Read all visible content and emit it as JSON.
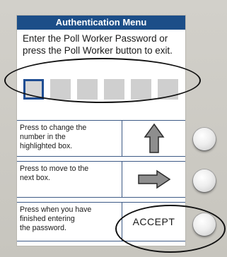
{
  "screen": {
    "title": "Authentication Menu",
    "prompt_line1": "Enter the Poll Worker Password or",
    "prompt_line2": "press the Poll Worker button to exit.",
    "password_box_count": 6,
    "active_box_index": 0
  },
  "rows": [
    {
      "line1": "Press to change the",
      "line2": "number in the",
      "line3": "highlighted box.",
      "glyph": "up-arrow-icon"
    },
    {
      "line1": "Press to move to the",
      "line2": "next box.",
      "line3": "",
      "glyph": "right-arrow-icon"
    },
    {
      "line1": "Press when you have",
      "line2": "finished entering",
      "line3": "the password.",
      "glyph": "ACCEPT"
    }
  ],
  "colors": {
    "title_bar": "#1c4e88",
    "active_box_border": "#1f4e93",
    "arrow_fill": "#8e8e8e",
    "box_fill": "#cfcfcf"
  }
}
